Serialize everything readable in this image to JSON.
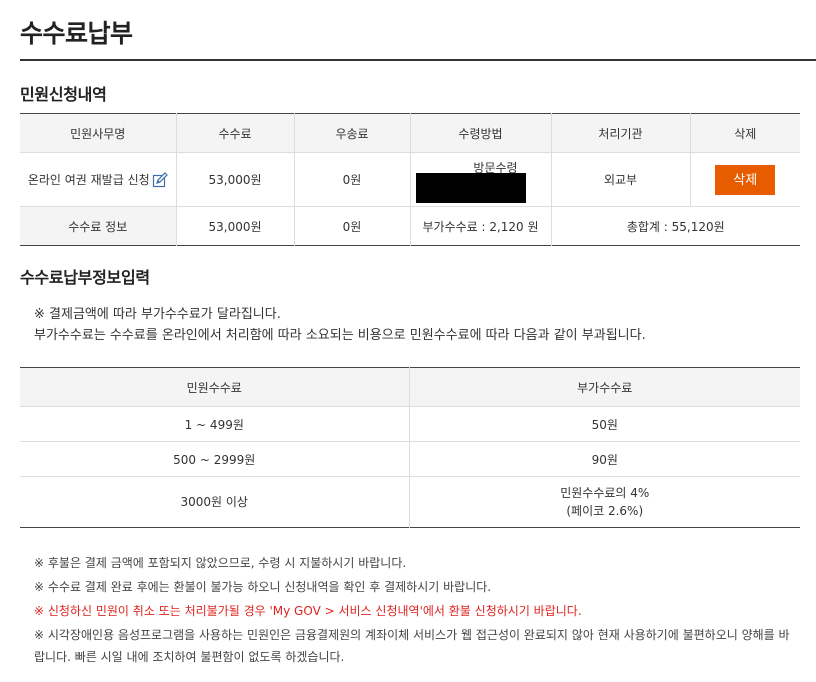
{
  "page_title": "수수료납부",
  "apply_section": {
    "title": "민원신청내역",
    "headers": [
      "민원사무명",
      "수수료",
      "우송료",
      "수령방법",
      "처리기관",
      "삭제"
    ],
    "row": {
      "name": "온라인 여권 재발급 신청",
      "fee": "53,000원",
      "postage": "0원",
      "receive_method": "방문수령",
      "agency": "외교부",
      "delete_label": "삭제"
    },
    "fee_info": {
      "label": "수수료 정보",
      "fee": "53,000원",
      "postage": "0원",
      "extra_fee": "부가수수료 : 2,120 원",
      "total": "총합계 : 55,120원"
    }
  },
  "payment_section": {
    "title": "수수료납부정보입력",
    "notice_line1": "※ 결제금액에 따라 부가수수료가 달라집니다.",
    "notice_line2": "부가수수료는 수수료를 온라인에서 처리함에 따라 소요되는 비용으로 민원수수료에 따라 다음과 같이 부과됩니다.",
    "table": {
      "headers": [
        "민원수수료",
        "부가수수료"
      ],
      "rows": [
        [
          "1 ~ 499원",
          "50원"
        ],
        [
          "500 ~ 2999원",
          "90원"
        ],
        [
          "3000원 이상",
          "민원수수료의 4%",
          "(페이코 2.6%)"
        ]
      ]
    }
  },
  "notes": [
    "※ 후불은 결제 금액에 포함되지 않았으므로, 수령 시 지불하시기 바랍니다.",
    "※ 수수료 결제 완료 후에는 환불이 불가능 하오니 신청내역을 확인 후 결제하시기 바랍니다.",
    "※ 신청하신 민원이 취소 또는 처리불가될 경우 'My GOV > 서비스 신청내역'에서 환불 신청하시기 바랍니다.",
    "※ 시각장애인용 음성프로그램을 사용하는 민원인은 금융결제원의 계좌이체 서비스가 웹 접근성이 완료되지 않아 현재 사용하기에 불편하오니 양해를 바랍니다. 빠른 시일 내에 조치하여 불편함이 없도록 하겠습니다."
  ],
  "colors": {
    "accent": "#e85c00",
    "warning": "#e0241f",
    "header_bg": "#f4f4f4"
  }
}
